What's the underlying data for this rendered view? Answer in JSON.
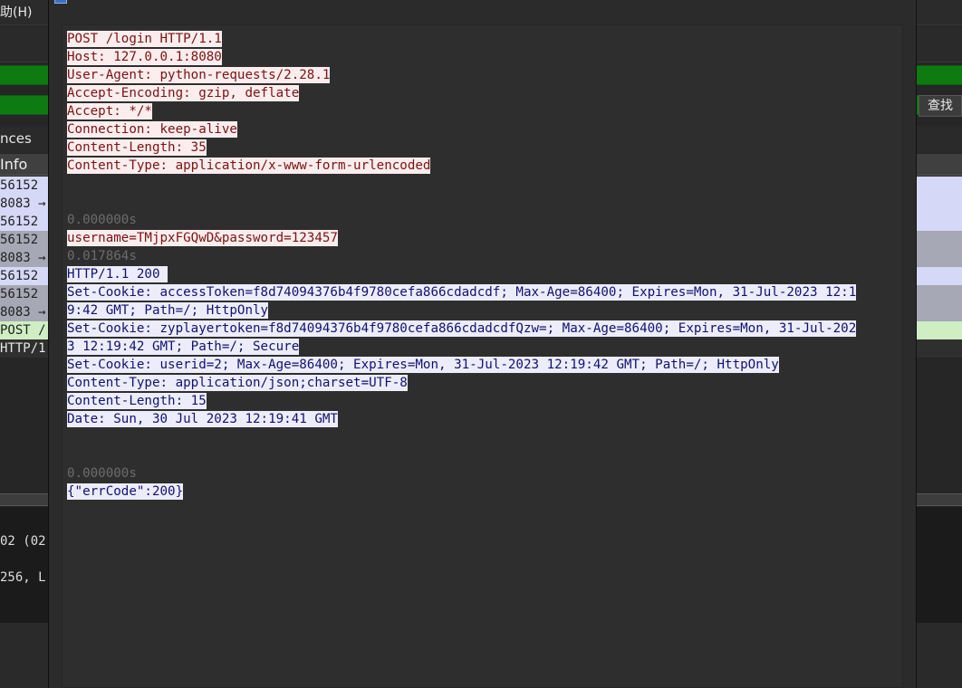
{
  "menu": {
    "help_label": "助(H)"
  },
  "search": {
    "find_label": "查找"
  },
  "prefs": {
    "label": "nces"
  },
  "packet_list": {
    "column_header": "Info",
    "rows": [
      {
        "text": "56152 -",
        "style": "a"
      },
      {
        "text": "8083 →",
        "style": "a"
      },
      {
        "text": "56152 -",
        "style": "a"
      },
      {
        "text": "56152 -",
        "style": "b"
      },
      {
        "text": "8083 →",
        "style": "b"
      },
      {
        "text": "56152 -",
        "style": "a"
      },
      {
        "text": "56152 -",
        "style": "b"
      },
      {
        "text": "8083 →",
        "style": "b"
      },
      {
        "text": "POST /",
        "style": "c"
      },
      {
        "text": "HTTP/1",
        "style": "d"
      }
    ]
  },
  "details": {
    "line1": "02 (02",
    "line2": "256, L"
  },
  "stream": {
    "request_lines": [
      "POST /login HTTP/1.1",
      "Host: 127.0.0.1:8080",
      "User-Agent: python-requests/2.28.1",
      "Accept-Encoding: gzip, deflate",
      "Accept: */*",
      "Connection: keep-alive",
      "Content-Length: 35",
      "Content-Type: application/x-www-form-urlencoded"
    ],
    "ts1": "0.000000s",
    "request_body": "username=TMjpxFGQwD&password=123457",
    "ts2": "0.017864s",
    "response_lines": [
      "HTTP/1.1 200 ",
      "Set-Cookie: accessToken=f8d74094376b4f9780cefa866cdadcdf; Max-Age=86400; Expires=Mon, 31-Jul-2023 12:1",
      "9:42 GMT; Path=/; HttpOnly",
      "Set-Cookie: zyplayertoken=f8d74094376b4f9780cefa866cdadcdfQzw=; Max-Age=86400; Expires=Mon, 31-Jul-202",
      "3 12:19:42 GMT; Path=/; Secure",
      "Set-Cookie: userid=2; Max-Age=86400; Expires=Mon, 31-Jul-2023 12:19:42 GMT; Path=/; HttpOnly",
      "Content-Type: application/json;charset=UTF-8",
      "Content-Length: 15",
      "Date: Sun, 30 Jul 2023 12:19:41 GMT"
    ],
    "ts3": "0.000000s",
    "response_body": "{\"errCode\":200}"
  },
  "colors": {
    "client_bg": "#fbeded",
    "client_fg": "#7a1212",
    "server_bg": "#ececfb",
    "server_fg": "#121270",
    "filter_bar": "#0e7a12"
  }
}
